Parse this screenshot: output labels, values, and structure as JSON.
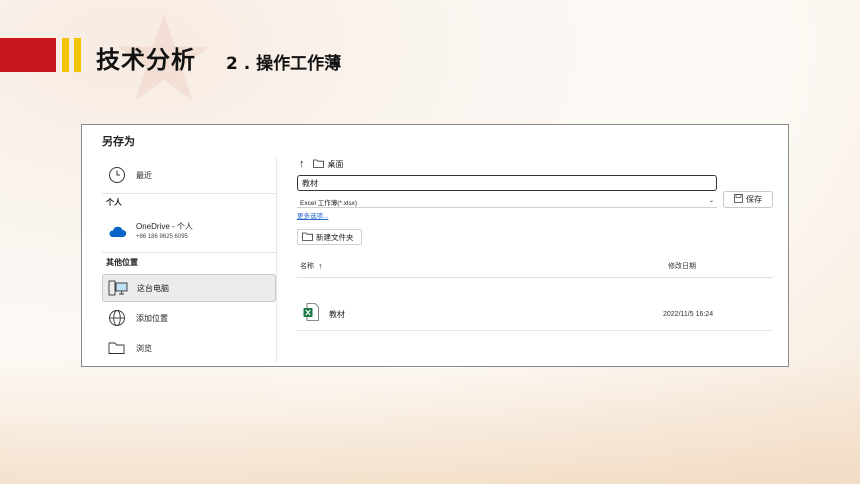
{
  "header": {
    "title": "技术分析",
    "subtitle": "2 . 操作工作薄"
  },
  "dialog": {
    "title": "另存为",
    "left_pane": {
      "recent_label": "最近",
      "personal_section": "个人",
      "onedrive_label": "OneDrive - 个人",
      "onedrive_phone": "+86 186 9625 6095",
      "other_section": "其他位置",
      "this_pc_label": "这台电脑",
      "add_location_label": "添加位置",
      "browse_label": "浏览"
    },
    "location": "桌面",
    "file_name_value": "教材",
    "file_type": "Excel 工作薄(*.xlsx)",
    "more_options": "更多选项...",
    "save_label": "保存",
    "new_folder_label": "新建文件夹",
    "columns": {
      "name": "名称",
      "modified": "修改日期"
    },
    "files": [
      {
        "name": "教材",
        "modified": "2022/11/5 16:24"
      }
    ]
  },
  "colors": {
    "header_red": "#c8161d",
    "header_yellow": "#f5c400",
    "onedrive_blue": "#0a64c8",
    "excel_green": "#1d7a45"
  }
}
